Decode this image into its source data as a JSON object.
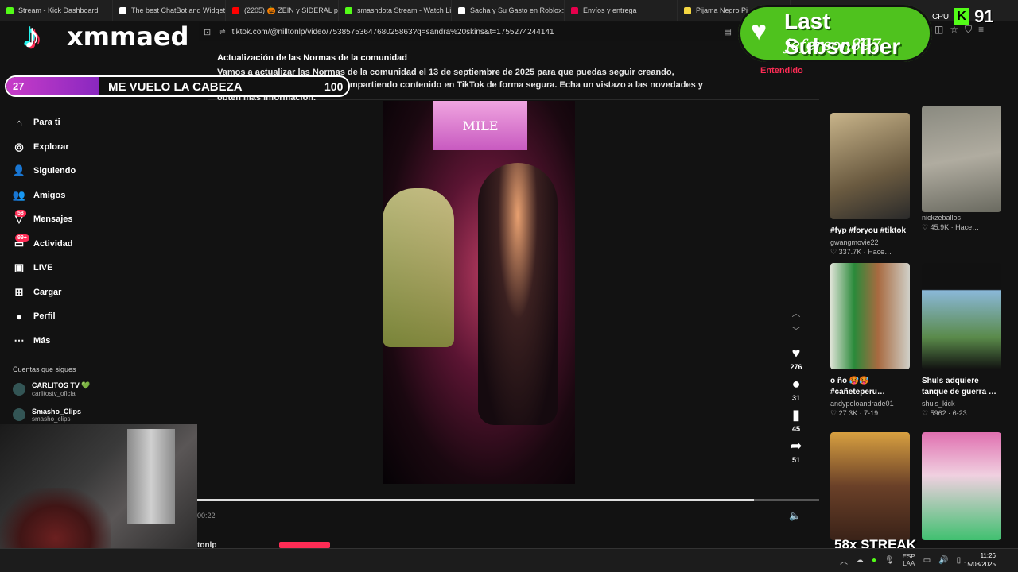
{
  "browser": {
    "tabs": [
      {
        "label": "Stream - Kick Dashboard",
        "color": "#53fc18"
      },
      {
        "label": "The best ChatBot and Widgets",
        "color": "#ffffff"
      },
      {
        "label": "(2205) 🎃 ZEIN y SIDERAL pra",
        "color": "#ff0000"
      },
      {
        "label": "smashdota Stream - Watch Liv",
        "color": "#53fc18"
      },
      {
        "label": "Sacha y Su Gasto en Roblox: M",
        "color": "#ffffff"
      },
      {
        "label": "Envíos y entrega",
        "color": "#e6004c"
      },
      {
        "label": "Pijama Negro Pi",
        "color": "#f5d742"
      }
    ],
    "url": "tiktok.com/@nilltonlp/video/7538575364768025863?q=sandra%20skins&t=1755274244141"
  },
  "notice": {
    "title": "Actualización de las Normas de la comunidad",
    "body": "Vamos a actualizar las Normas de la comunidad el 13 de septiembre de 2025 para que puedas seguir creando, descubriendo experiencias y compartiendo contenido en TikTok de forma segura. Echa un vistazo a las novedades y obtén más información.",
    "accept": "Entendido"
  },
  "sidebar": {
    "items": [
      {
        "label": "Para ti",
        "icon": "⌂",
        "badge": ""
      },
      {
        "label": "Explorar",
        "icon": "◎",
        "badge": ""
      },
      {
        "label": "Siguiendo",
        "icon": "👤",
        "badge": ""
      },
      {
        "label": "Amigos",
        "icon": "👥",
        "badge": ""
      },
      {
        "label": "Mensajes",
        "icon": "▽",
        "badge": "58"
      },
      {
        "label": "Actividad",
        "icon": "▭",
        "badge": "99+"
      },
      {
        "label": "LIVE",
        "icon": "▣",
        "badge": ""
      },
      {
        "label": "Cargar",
        "icon": "⊞",
        "badge": ""
      },
      {
        "label": "Perfil",
        "icon": "●",
        "badge": ""
      },
      {
        "label": "Más",
        "icon": "⋯",
        "badge": ""
      }
    ],
    "following_header": "Cuentas que sigues",
    "accounts": [
      {
        "name": "CARLITOS TV 💚",
        "handle": "carlitostv_oficial"
      },
      {
        "name": "Smasho_Clips",
        "handle": "smasho_clips"
      }
    ]
  },
  "video": {
    "screen_text": "MILE",
    "elapsed": "00:22",
    "progress": 0.895,
    "author_partial": "tonlp"
  },
  "actions": {
    "likes": "276",
    "comments": "31",
    "saves": "45",
    "shares": "51"
  },
  "recommended": [
    {
      "title": "#fyp #foryou #tiktok",
      "author": "gwangmovie22",
      "stat": "♡ 337.7K · Hace…"
    },
    {
      "title": "",
      "author": "nickzeballos",
      "stat": "♡ 45.9K · Hace…"
    },
    {
      "title": "o ño 🥵🥵 #cañeteperu…",
      "author": "andypoloandrade01",
      "stat": "♡ 27.3K · 7-19"
    },
    {
      "title": "Shuls adquiere tanque de guerra …",
      "author": "shuls_kick",
      "stat": "♡ 5962 · 6-23"
    },
    {
      "title": "",
      "author": "",
      "stat": ""
    },
    {
      "title": "",
      "author": "",
      "stat": ""
    }
  ],
  "overlays": {
    "brand": "xmmaed",
    "counter_current": "27",
    "counter_label": "ME VUELO LA CABEZA",
    "counter_goal": "100",
    "counter_progress": 0.27,
    "last_sub_title": "Last Subscriber",
    "last_sub_user": "jeferson897",
    "cpu_label": "CPU",
    "kick_letter": "K",
    "cpu_value": "91",
    "streak": "58x STREAK"
  },
  "taskbar": {
    "lang_top": "ESP",
    "lang_bottom": "LAA",
    "time": "11:26",
    "date": "15/08/2025"
  }
}
